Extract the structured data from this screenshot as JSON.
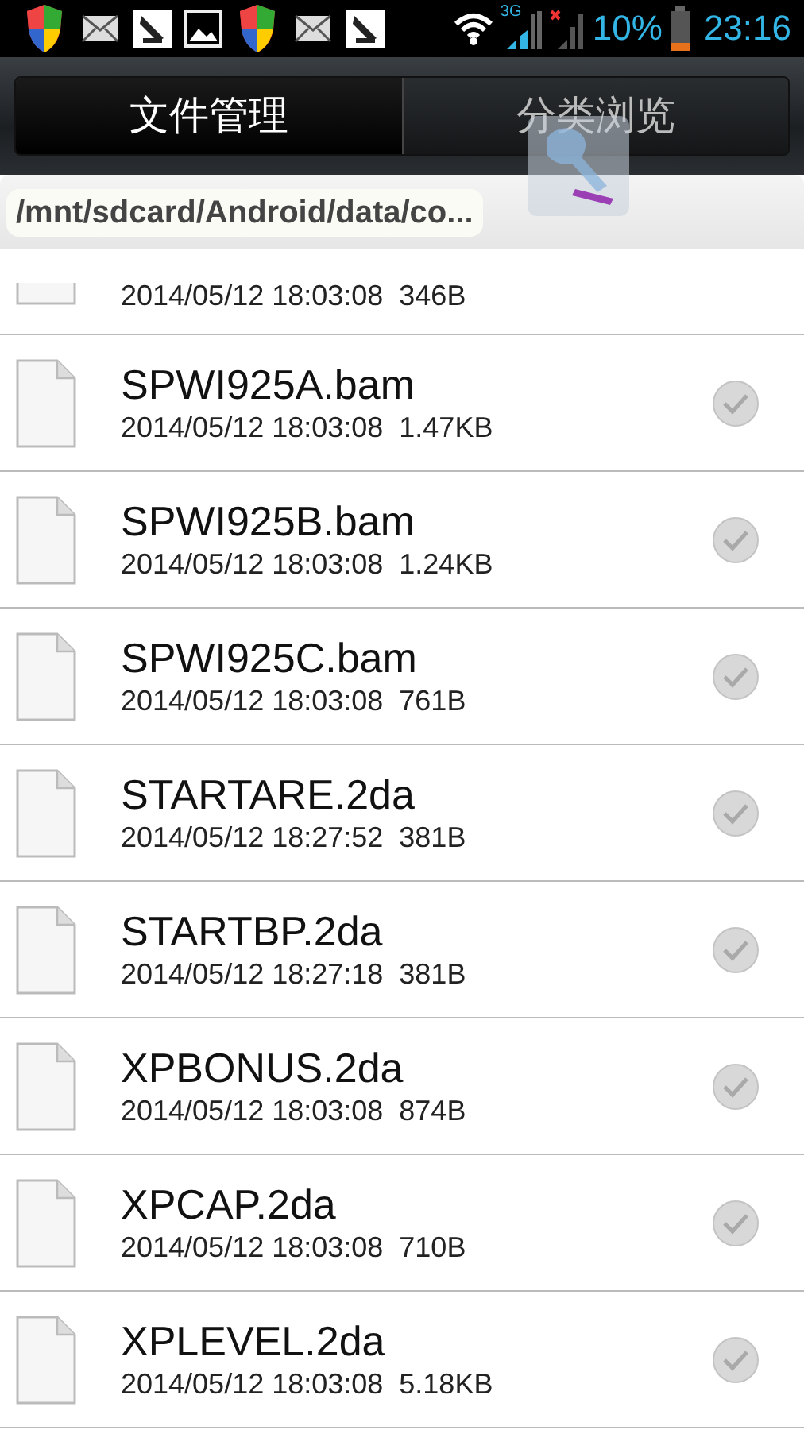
{
  "status_bar": {
    "battery_text": "10%",
    "time": "23:16",
    "signal_1_label": "3G"
  },
  "tabs": [
    {
      "label": "文件管理",
      "selected": true
    },
    {
      "label": "分类浏览",
      "selected": false
    }
  ],
  "path": "/mnt/sdcard/Android/data/co...",
  "files": [
    {
      "kind": "partial",
      "date": "2014/05/12 18:03:08",
      "size": "346B"
    },
    {
      "kind": "file",
      "name": "SPWI925A.bam",
      "date": "2014/05/12 18:03:08",
      "size": "1.47KB",
      "checked": false
    },
    {
      "kind": "file",
      "name": "SPWI925B.bam",
      "date": "2014/05/12 18:03:08",
      "size": "1.24KB",
      "checked": false
    },
    {
      "kind": "file",
      "name": "SPWI925C.bam",
      "date": "2014/05/12 18:03:08",
      "size": "761B",
      "checked": false
    },
    {
      "kind": "file",
      "name": "STARTARE.2da",
      "date": "2014/05/12 18:27:52",
      "size": "381B",
      "checked": false
    },
    {
      "kind": "file",
      "name": "STARTBP.2da",
      "date": "2014/05/12 18:27:18",
      "size": "381B",
      "checked": false
    },
    {
      "kind": "file",
      "name": "XPBONUS.2da",
      "date": "2014/05/12 18:03:08",
      "size": "874B",
      "checked": false
    },
    {
      "kind": "file",
      "name": "XPCAP.2da",
      "date": "2014/05/12 18:03:08",
      "size": "710B",
      "checked": false
    },
    {
      "kind": "file",
      "name": "XPLEVEL.2da",
      "date": "2014/05/12 18:03:08",
      "size": "5.18KB",
      "checked": false
    }
  ]
}
